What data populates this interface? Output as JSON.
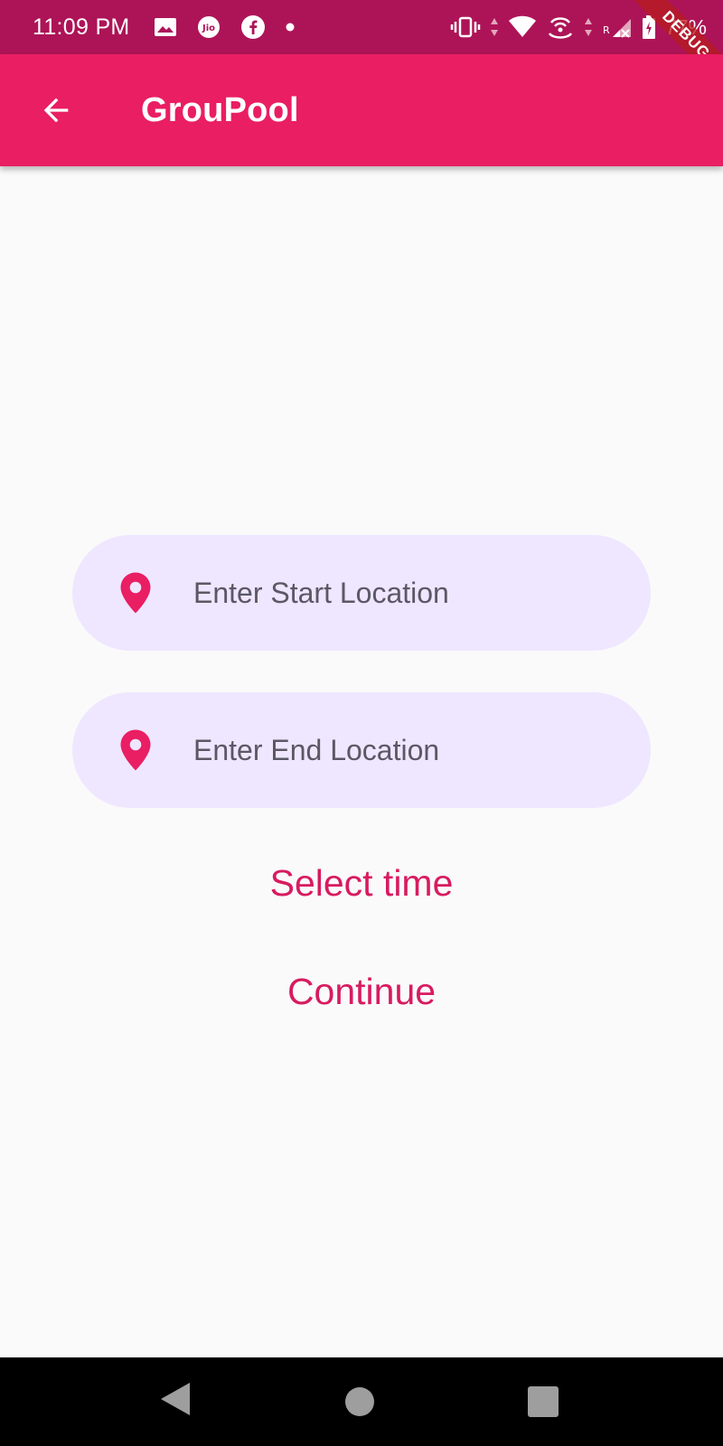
{
  "status_bar": {
    "time": "11:09 PM",
    "battery": "77%",
    "debug_label": "DEBUG"
  },
  "app_bar": {
    "title": "GrouPool"
  },
  "form": {
    "start_placeholder": "Enter Start Location",
    "end_placeholder": "Enter End Location",
    "select_time_label": "Select time",
    "continue_label": "Continue"
  },
  "colors": {
    "status_bar": "#ad1457",
    "app_bar": "#e91e63",
    "accent": "#d81b60",
    "field_background": "#efe6ff",
    "background": "#fafafa"
  },
  "icons": {
    "back": "arrow-back-icon",
    "field": "location-pin-icon"
  }
}
